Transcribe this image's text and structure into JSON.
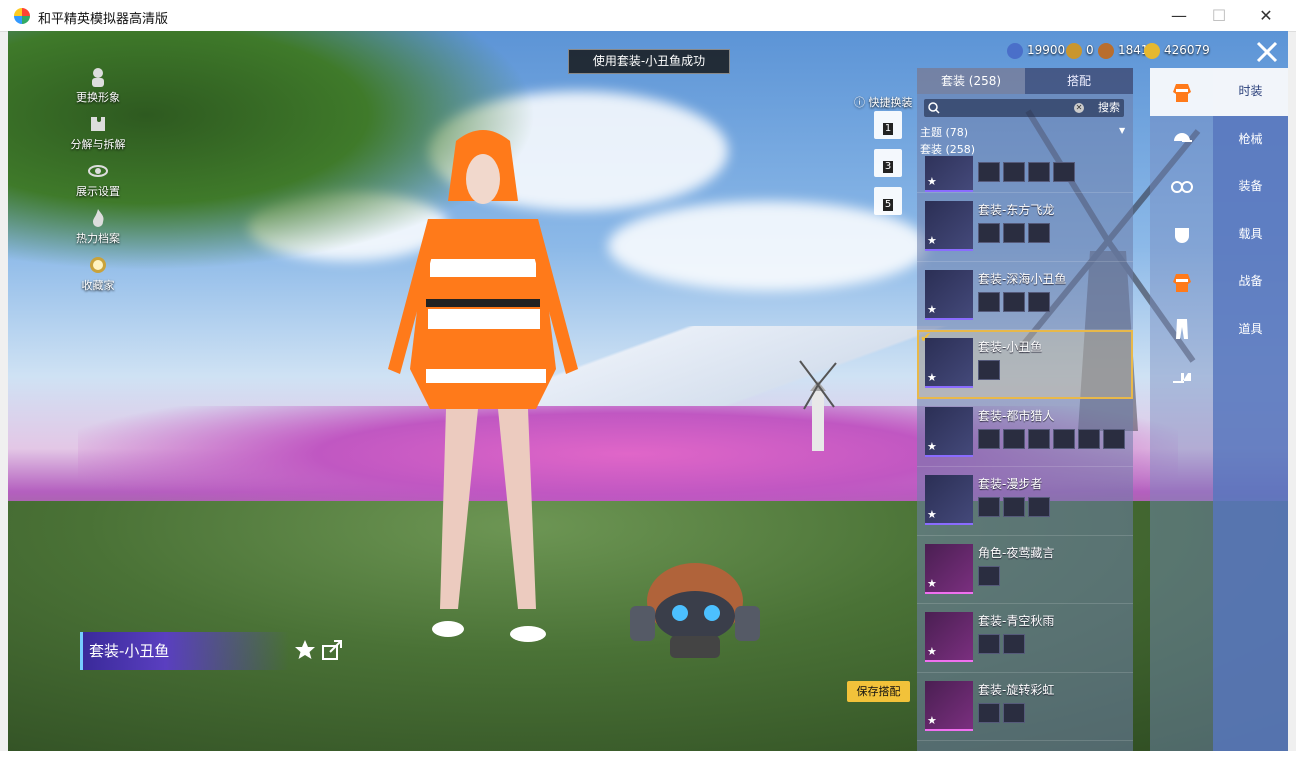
{
  "window": {
    "title": "和平精英模拟器高清版",
    "min": "—",
    "max": "☐",
    "close": "✕"
  },
  "left_menu": [
    {
      "label": "更换形象",
      "icon": "person-icon"
    },
    {
      "label": "分解与拆解",
      "icon": "puzzle-icon"
    },
    {
      "label": "展示设置",
      "icon": "eye-icon"
    },
    {
      "label": "热力档案",
      "icon": "fire-icon"
    },
    {
      "label": "收藏家",
      "icon": "badge-icon"
    }
  ],
  "toast": "使用套装-小丑鱼成功",
  "currencies": [
    {
      "value": "19900",
      "color": "#4a6fc9"
    },
    {
      "value": "0",
      "color": "#c9962e"
    },
    {
      "value": "1841",
      "color": "#b96e2e"
    },
    {
      "value": "426079",
      "color": "#e6b830"
    }
  ],
  "quick_change": {
    "label": "快捷换装",
    "slots": [
      "1",
      "3",
      "5"
    ]
  },
  "panel": {
    "tabs": [
      "套装 (258)",
      "搭配"
    ],
    "search_placeholder": "",
    "search_button": "搜索",
    "filter_theme": "主题 (78)",
    "filter_set": "套装 (258)",
    "items": [
      {
        "title": "",
        "parts": 4,
        "color": "blue"
      },
      {
        "title": "套装-东方飞龙",
        "parts": 3,
        "color": "blue"
      },
      {
        "title": "套装-深海小丑鱼",
        "parts": 3,
        "color": "blue"
      },
      {
        "title": "套装-小丑鱼",
        "parts": 1,
        "color": "blue",
        "selected": true
      },
      {
        "title": "套装-都市猎人",
        "parts": 6,
        "color": "blue"
      },
      {
        "title": "套装-漫步者",
        "parts": 3,
        "color": "blue"
      },
      {
        "title": "角色-夜莺藏言",
        "parts": 1,
        "color": "pink"
      },
      {
        "title": "套装-青空秋雨",
        "parts": 2,
        "color": "pink"
      },
      {
        "title": "套装-旋转彩虹",
        "parts": 2,
        "color": "pink"
      }
    ]
  },
  "categories": [
    "outfit-icon",
    "cap-icon",
    "goggles-icon",
    "mask-icon",
    "top-icon",
    "pants-icon",
    "shoes-icon"
  ],
  "right_tabs": [
    "时装",
    "枪械",
    "装备",
    "载具",
    "战备",
    "道具"
  ],
  "outfit_name": "套装-小丑鱼",
  "save_button": "保存搭配"
}
